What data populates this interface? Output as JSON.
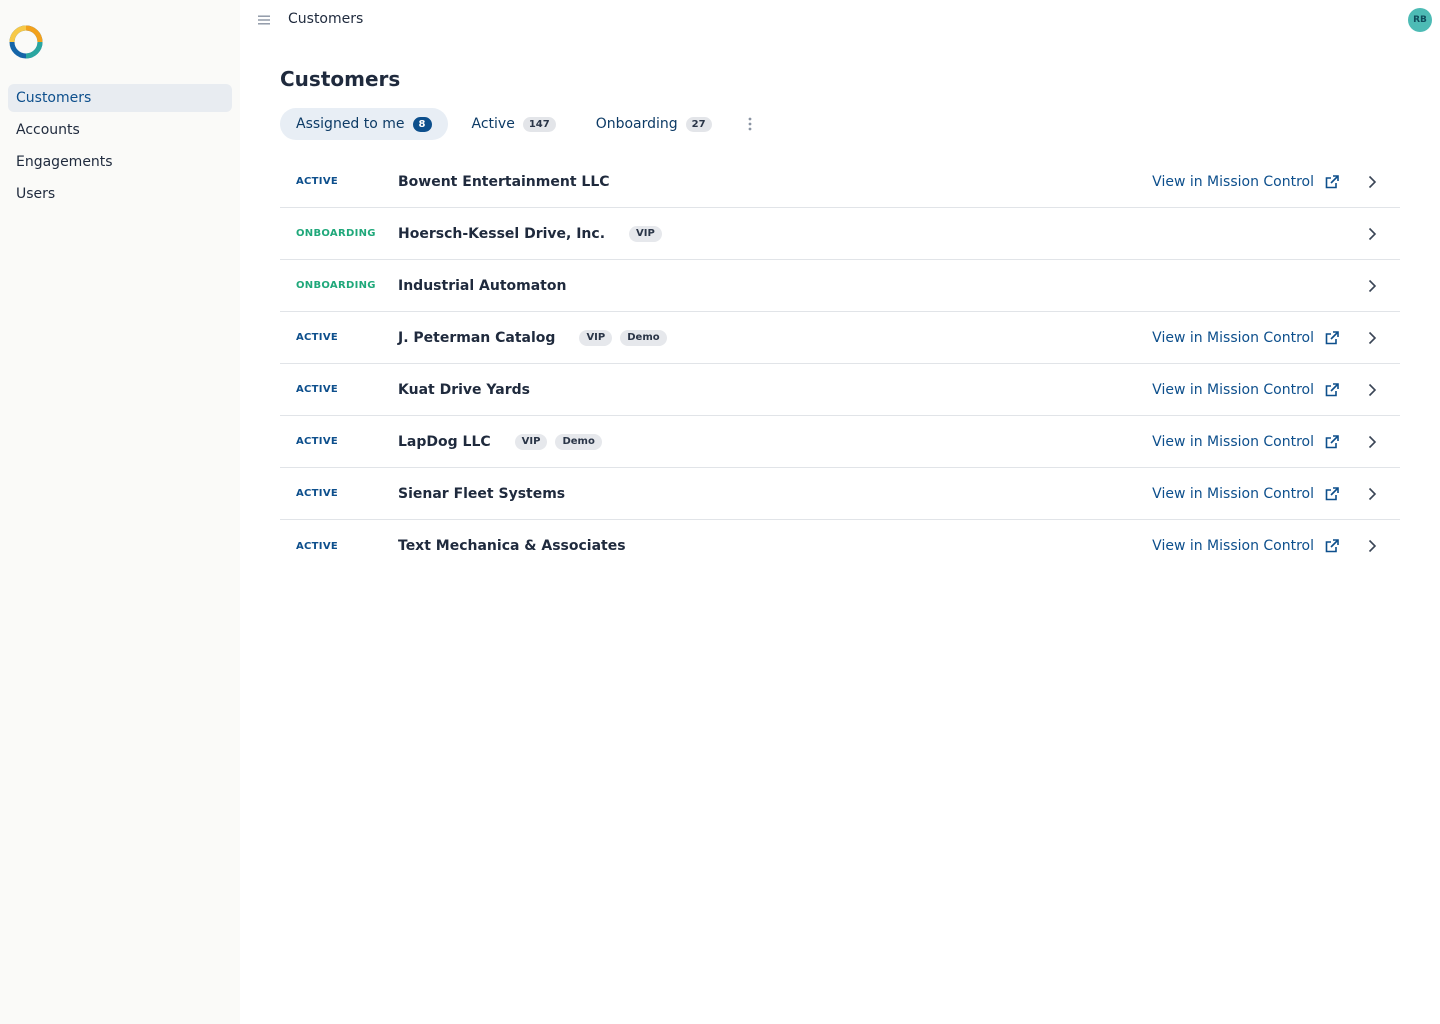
{
  "sidebar": {
    "items": [
      {
        "label": "Customers",
        "active": true
      },
      {
        "label": "Accounts",
        "active": false
      },
      {
        "label": "Engagements",
        "active": false
      },
      {
        "label": "Users",
        "active": false
      }
    ]
  },
  "topbar": {
    "title": "Customers",
    "avatar_initials": "RB",
    "avatar_color": "#4dbbb5"
  },
  "main": {
    "title": "Customers",
    "tabs": [
      {
        "label": "Assigned to me",
        "count": "8",
        "active": true
      },
      {
        "label": "Active",
        "count": "147",
        "active": false
      },
      {
        "label": "Onboarding",
        "count": "27",
        "active": false
      }
    ],
    "link_label": "View in Mission Control",
    "rows": [
      {
        "status": "ACTIVE",
        "kind": "active",
        "name": "Bowent Entertainment LLC",
        "tags": [],
        "link": true
      },
      {
        "status": "ONBOARDING",
        "kind": "onboarding",
        "name": "Hoersch-Kessel Drive, Inc.",
        "tags": [
          "VIP"
        ],
        "link": false
      },
      {
        "status": "ONBOARDING",
        "kind": "onboarding",
        "name": "Industrial Automaton",
        "tags": [],
        "link": false
      },
      {
        "status": "ACTIVE",
        "kind": "active",
        "name": "J. Peterman Catalog",
        "tags": [
          "VIP",
          "Demo"
        ],
        "link": true
      },
      {
        "status": "ACTIVE",
        "kind": "active",
        "name": "Kuat Drive Yards",
        "tags": [],
        "link": true
      },
      {
        "status": "ACTIVE",
        "kind": "active",
        "name": "LapDog LLC",
        "tags": [
          "VIP",
          "Demo"
        ],
        "link": true
      },
      {
        "status": "ACTIVE",
        "kind": "active",
        "name": "Sienar Fleet Systems",
        "tags": [],
        "link": true
      },
      {
        "status": "ACTIVE",
        "kind": "active",
        "name": "Text Mechanica & Associates",
        "tags": [],
        "link": true
      }
    ]
  },
  "colors": {
    "accent": "#0d4f8c",
    "onboarding": "#1fa87a",
    "sidebar_bg": "#fafaf8"
  }
}
